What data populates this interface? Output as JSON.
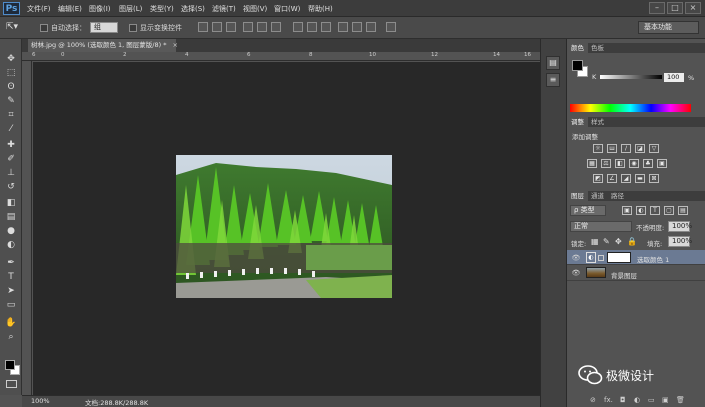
{
  "app": {
    "logo": "Ps"
  },
  "menu": [
    "文件(F)",
    "编辑(E)",
    "图像(I)",
    "图层(L)",
    "类型(Y)",
    "选择(S)",
    "滤镜(T)",
    "视图(V)",
    "窗口(W)",
    "帮助(H)"
  ],
  "window_controls": {
    "minimize": "–",
    "restore": "□",
    "close": "×"
  },
  "options": {
    "auto_select_label": "自动选择：",
    "auto_select_value": "组",
    "show_transform_label": "显示变换控件",
    "workspace": "基本功能"
  },
  "document": {
    "tab_title": "树林.jpg @ 100% (选取颜色 1, 图层蒙版/8) *",
    "tab_close": "×",
    "ruler_h_ticks": [
      "6",
      "0",
      "2",
      "4",
      "6",
      "8",
      "10",
      "12",
      "14",
      "16"
    ],
    "zoom": "100%",
    "doc_size": "文档:288.8K/288.8K"
  },
  "toolbar_icons": [
    "move-icon",
    "marquee-icon",
    "lasso-icon",
    "quick-select-icon",
    "crop-icon",
    "eyedropper-icon",
    "healing-icon",
    "brush-icon",
    "clone-stamp-icon",
    "history-brush-icon",
    "eraser-icon",
    "gradient-icon",
    "blur-icon",
    "dodge-icon",
    "pen-icon",
    "type-icon",
    "path-select-icon",
    "shape-icon",
    "hand-icon",
    "zoom-icon"
  ],
  "color_panel": {
    "tabs": [
      "颜色",
      "色板"
    ],
    "channel": "K",
    "value": "100",
    "unit": "%"
  },
  "adjustments_panel": {
    "tabs": [
      "调整",
      "样式"
    ],
    "heading": "添加调整"
  },
  "layers_panel": {
    "tabs": [
      "图层",
      "通道",
      "路径"
    ],
    "filter_label": "ρ 类型",
    "blend_mode": "正常",
    "opacity_label": "不透明度:",
    "opacity_value": "100%",
    "lock_label": "锁定:",
    "fill_label": "填充:",
    "fill_value": "100%",
    "layers": [
      {
        "name": "选取颜色 1",
        "selected": true
      },
      {
        "name": "背景图层",
        "selected": false
      }
    ]
  },
  "watermark": "极微设计"
}
